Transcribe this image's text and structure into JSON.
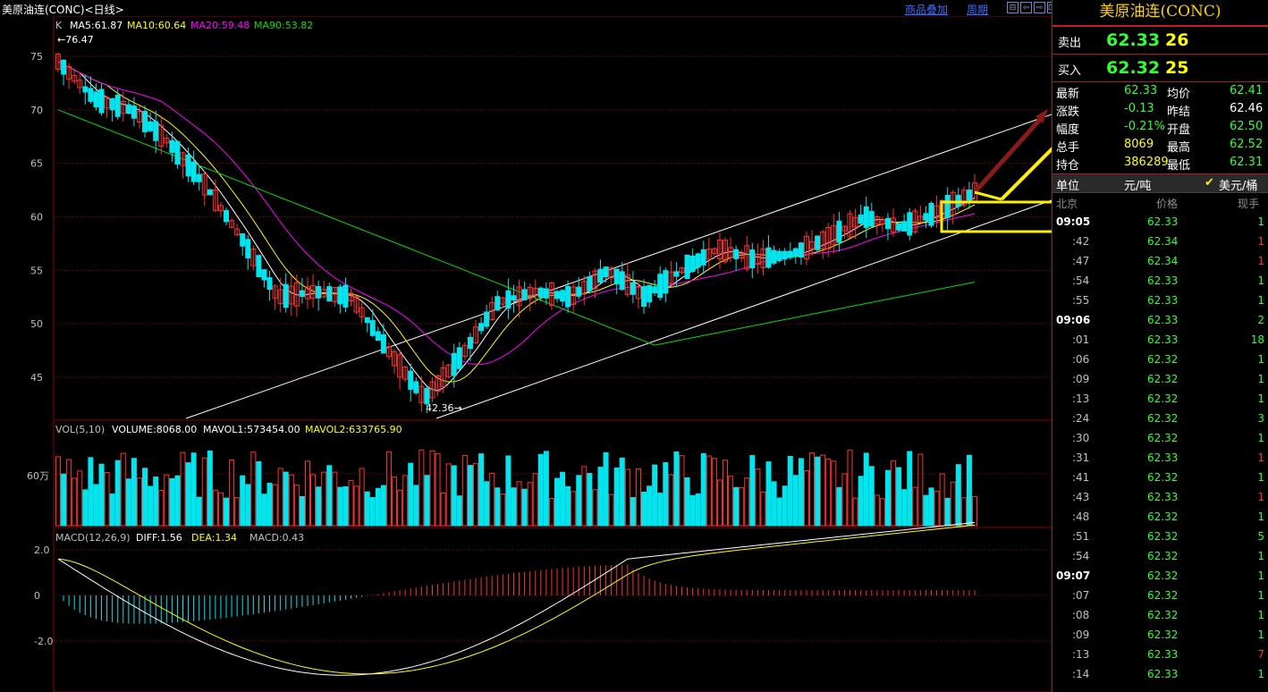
{
  "header": {
    "title": "美原油连(CONC)<日线>",
    "link_overlay": "商品叠加",
    "link_period": "周期",
    "nav_buttons": [
      "⊟",
      "⇦",
      "⇨",
      "⊡"
    ]
  },
  "indicators": {
    "kline_prefix": "K",
    "ma5": "MA5:61.87",
    "ma10": "MA10:60.64",
    "ma20": "MA20:59.48",
    "ma90": "MA90:53.82",
    "high_label": "←76.47",
    "low_label": "42.36→",
    "vol_title": "VOL(5,10)",
    "volume": "VOLUME:8068.00",
    "mavol1": "MAVOL1:573454.00",
    "mavol2": "MAVOL2:633765.90",
    "vol_axis": "60万",
    "macd_title": "MACD(12,26,9)",
    "diff": "DIFF:1.56",
    "dea": "DEA:1.34",
    "macd": "MACD:0.43"
  },
  "colors": {
    "up": "#ff3030",
    "down": "#00e5ee",
    "ma5": "#ffffff",
    "ma10": "#ffff00",
    "ma20": "#ff00ff",
    "ma90": "#00dd00",
    "grid": "#8b0000",
    "trend": "#ffffff",
    "highlight": "#ffee00"
  },
  "chart_data": {
    "type": "candlestick",
    "price_axis_ticks": [
      "75",
      "70",
      "65",
      "60",
      "55",
      "50",
      "45"
    ],
    "macd_axis_ticks": [
      "2.0",
      "0",
      "-2.0"
    ],
    "ohlc_waypoints": [
      [
        75.0,
        76.5,
        72.5,
        74.5
      ],
      [
        74.0,
        75.0,
        70.5,
        71.0
      ],
      [
        71.5,
        73.0,
        69.0,
        70.0
      ],
      [
        68.0,
        69.0,
        66.0,
        67.0
      ],
      [
        66.0,
        67.5,
        62.0,
        63.0
      ],
      [
        62.5,
        63.5,
        57.0,
        58.0
      ],
      [
        56.0,
        57.0,
        52.0,
        52.5
      ],
      [
        51.0,
        53.5,
        50.0,
        53.0
      ],
      [
        52.0,
        53.5,
        51.0,
        52.5
      ],
      [
        51.0,
        52.0,
        47.0,
        47.5
      ],
      [
        46.5,
        47.5,
        42.4,
        43.0
      ],
      [
        44.0,
        47.5,
        43.5,
        47.0
      ],
      [
        48.0,
        52.5,
        47.5,
        52.0
      ],
      [
        51.5,
        53.5,
        50.5,
        53.0
      ],
      [
        53.0,
        54.5,
        52.0,
        52.5
      ],
      [
        53.0,
        55.5,
        52.5,
        55.0
      ],
      [
        54.0,
        55.0,
        51.5,
        52.5
      ],
      [
        53.0,
        55.5,
        52.5,
        55.0
      ],
      [
        55.5,
        57.5,
        55.0,
        57.0
      ],
      [
        56.5,
        57.5,
        55.5,
        56.0
      ],
      [
        56.0,
        57.0,
        55.0,
        56.5
      ],
      [
        57.0,
        58.5,
        56.0,
        58.0
      ],
      [
        58.0,
        60.5,
        57.5,
        60.0
      ],
      [
        59.5,
        60.5,
        58.5,
        59.0
      ],
      [
        59.0,
        61.0,
        58.5,
        60.5
      ],
      [
        60.5,
        62.5,
        60.0,
        62.3
      ]
    ],
    "moving_averages": [
      "MA5",
      "MA10",
      "MA20",
      "MA90"
    ]
  },
  "right_panel": {
    "name": "美原油连(CONC)",
    "ask_label": "卖出",
    "ask_price": "62.33",
    "ask_vol": "26",
    "bid_label": "买入",
    "bid_price": "62.32",
    "bid_vol": "25",
    "stats": [
      {
        "l": "最新",
        "v": "62.33",
        "c": "#30ff30",
        "l2": "均价",
        "v2": "62.41",
        "c2": "#30ff30"
      },
      {
        "l": "涨跌",
        "v": "-0.13",
        "c": "#30ff30",
        "l2": "昨结",
        "v2": "62.46",
        "c2": "#ffffff"
      },
      {
        "l": "幅度",
        "v": "-0.21%",
        "c": "#30ff30",
        "l2": "开盘",
        "v2": "62.50",
        "c2": "#30ff30"
      },
      {
        "l": "总手",
        "v": "8069",
        "c": "#ffff00",
        "l2": "最高",
        "v2": "62.52",
        "c2": "#30ff30"
      },
      {
        "l": "持仓",
        "v": "386289",
        "c": "#ffff00",
        "l2": "最低",
        "v2": "62.31",
        "c2": "#30ff30"
      }
    ],
    "unit_label": "单位",
    "unit_value": "元/吨",
    "unit_check": "✔",
    "unit_usd": "美元/桶",
    "table_headers": [
      "北京",
      "价格",
      "现手"
    ],
    "ticks": [
      {
        "t": "09:05",
        "p": "62.33",
        "v": "1",
        "vc": "#30ff30",
        "major": true
      },
      {
        "t": ":42",
        "p": "62.34",
        "v": "1",
        "vc": "#ff3030"
      },
      {
        "t": ":47",
        "p": "62.34",
        "v": "1",
        "vc": "#ff3030"
      },
      {
        "t": ":54",
        "p": "62.33",
        "v": "1",
        "vc": "#30ff30"
      },
      {
        "t": ":55",
        "p": "62.33",
        "v": "1",
        "vc": "#30ff30"
      },
      {
        "t": "09:06",
        "p": "62.33",
        "v": "2",
        "vc": "#30ff30",
        "major": true
      },
      {
        "t": ":01",
        "p": "62.33",
        "v": "18",
        "vc": "#30ff30"
      },
      {
        "t": ":06",
        "p": "62.32",
        "v": "1",
        "vc": "#30ff30"
      },
      {
        "t": ":09",
        "p": "62.32",
        "v": "1",
        "vc": "#30ff30"
      },
      {
        "t": ":13",
        "p": "62.32",
        "v": "1",
        "vc": "#30ff30"
      },
      {
        "t": ":24",
        "p": "62.32",
        "v": "3",
        "vc": "#30ff30"
      },
      {
        "t": ":30",
        "p": "62.32",
        "v": "1",
        "vc": "#30ff30"
      },
      {
        "t": ":31",
        "p": "62.33",
        "v": "1",
        "vc": "#ff3030"
      },
      {
        "t": ":41",
        "p": "62.32",
        "v": "1",
        "vc": "#30ff30"
      },
      {
        "t": ":43",
        "p": "62.33",
        "v": "1",
        "vc": "#ff3030"
      },
      {
        "t": ":48",
        "p": "62.32",
        "v": "1",
        "vc": "#30ff30"
      },
      {
        "t": ":51",
        "p": "62.32",
        "v": "5",
        "vc": "#30ff30"
      },
      {
        "t": ":54",
        "p": "62.32",
        "v": "1",
        "vc": "#30ff30"
      },
      {
        "t": "09:07",
        "p": "62.32",
        "v": "1",
        "vc": "#30ff30",
        "major": true
      },
      {
        "t": ":07",
        "p": "62.32",
        "v": "1",
        "vc": "#30ff30"
      },
      {
        "t": ":08",
        "p": "62.32",
        "v": "1",
        "vc": "#30ff30"
      },
      {
        "t": ":09",
        "p": "62.32",
        "v": "1",
        "vc": "#30ff30"
      },
      {
        "t": ":13",
        "p": "62.33",
        "v": "7",
        "vc": "#ff3030"
      },
      {
        "t": ":14",
        "p": "62.33",
        "v": "1",
        "vc": "#30ff30"
      }
    ]
  }
}
